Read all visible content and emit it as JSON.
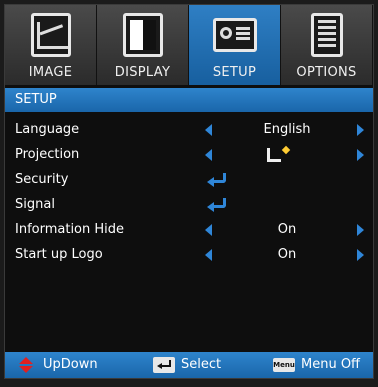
{
  "tabs": [
    {
      "label": "IMAGE",
      "icon": "image-icon",
      "active": false
    },
    {
      "label": "DISPLAY",
      "icon": "display-icon",
      "active": false
    },
    {
      "label": "SETUP",
      "icon": "setup-icon",
      "active": true
    },
    {
      "label": "OPTIONS",
      "icon": "options-icon",
      "active": false
    }
  ],
  "header": {
    "title": "SETUP"
  },
  "menu": [
    {
      "label": "Language",
      "value": "English",
      "control": "arrows"
    },
    {
      "label": "Projection",
      "value": "",
      "control": "arrows",
      "value_icon": "front-table-projection-icon"
    },
    {
      "label": "Security",
      "value": "",
      "control": "enter"
    },
    {
      "label": "Signal",
      "value": "",
      "control": "enter"
    },
    {
      "label": "Information Hide",
      "value": "On",
      "control": "arrows"
    },
    {
      "label": "Start up Logo",
      "value": "On",
      "control": "arrows"
    }
  ],
  "footer": {
    "updown": "UpDown",
    "select": "Select",
    "menu_key": "Menu",
    "menu_off": "Menu Off"
  },
  "colors": {
    "accent": "#2f86d8",
    "tab_active": "#1f6fb5",
    "updown_arrows": "#e02020"
  }
}
